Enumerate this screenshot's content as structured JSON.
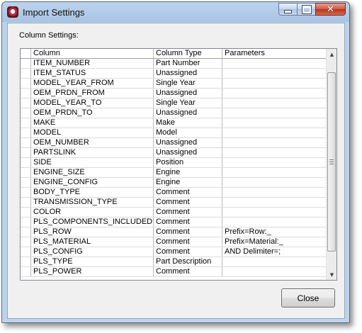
{
  "window": {
    "title": "Import Settings"
  },
  "title_icons": {
    "app": "app-icon",
    "minimize": "minimize-icon",
    "maximize": "maximize-icon",
    "close": "close-icon"
  },
  "section_label": "Column Settings:",
  "grid": {
    "columns": [
      "Column",
      "Column Type",
      "Parameters"
    ],
    "rows": [
      {
        "column": "ITEM_NUMBER",
        "type": "Part Number",
        "params": ""
      },
      {
        "column": "ITEM_STATUS",
        "type": "Unassigned",
        "params": ""
      },
      {
        "column": "MODEL_YEAR_FROM",
        "type": "Single Year",
        "params": ""
      },
      {
        "column": "OEM_PRDN_FROM",
        "type": "Unassigned",
        "params": ""
      },
      {
        "column": "MODEL_YEAR_TO",
        "type": "Single Year",
        "params": ""
      },
      {
        "column": "OEM_PRDN_TO",
        "type": "Unassigned",
        "params": ""
      },
      {
        "column": "MAKE",
        "type": "Make",
        "params": ""
      },
      {
        "column": "MODEL",
        "type": "Model",
        "params": ""
      },
      {
        "column": "OEM_NUMBER",
        "type": "Unassigned",
        "params": ""
      },
      {
        "column": "PARTSLINK",
        "type": "Unassigned",
        "params": ""
      },
      {
        "column": "SIDE",
        "type": "Position",
        "params": ""
      },
      {
        "column": "ENGINE_SIZE",
        "type": "Engine",
        "params": ""
      },
      {
        "column": "ENGINE_CONFIG",
        "type": "Engine",
        "params": ""
      },
      {
        "column": "BODY_TYPE",
        "type": "Comment",
        "params": ""
      },
      {
        "column": "TRANSMISSION_TYPE",
        "type": "Comment",
        "params": ""
      },
      {
        "column": "COLOR",
        "type": "Comment",
        "params": ""
      },
      {
        "column": "PLS_COMPONENTS_INCLUDED",
        "type": "Comment",
        "params": ""
      },
      {
        "column": "PLS_ROW",
        "type": "Comment",
        "params": "Prefix=Row:_"
      },
      {
        "column": "PLS_MATERIAL",
        "type": "Comment",
        "params": "Prefix=Material:_"
      },
      {
        "column": "PLS_CONFIG",
        "type": "Comment",
        "params": "AND Delimiter=;"
      },
      {
        "column": "PLS_TYPE",
        "type": "Part Description",
        "params": ""
      },
      {
        "column": "PLS_POWER",
        "type": "Comment",
        "params": ""
      }
    ]
  },
  "buttons": {
    "close": "Close"
  }
}
